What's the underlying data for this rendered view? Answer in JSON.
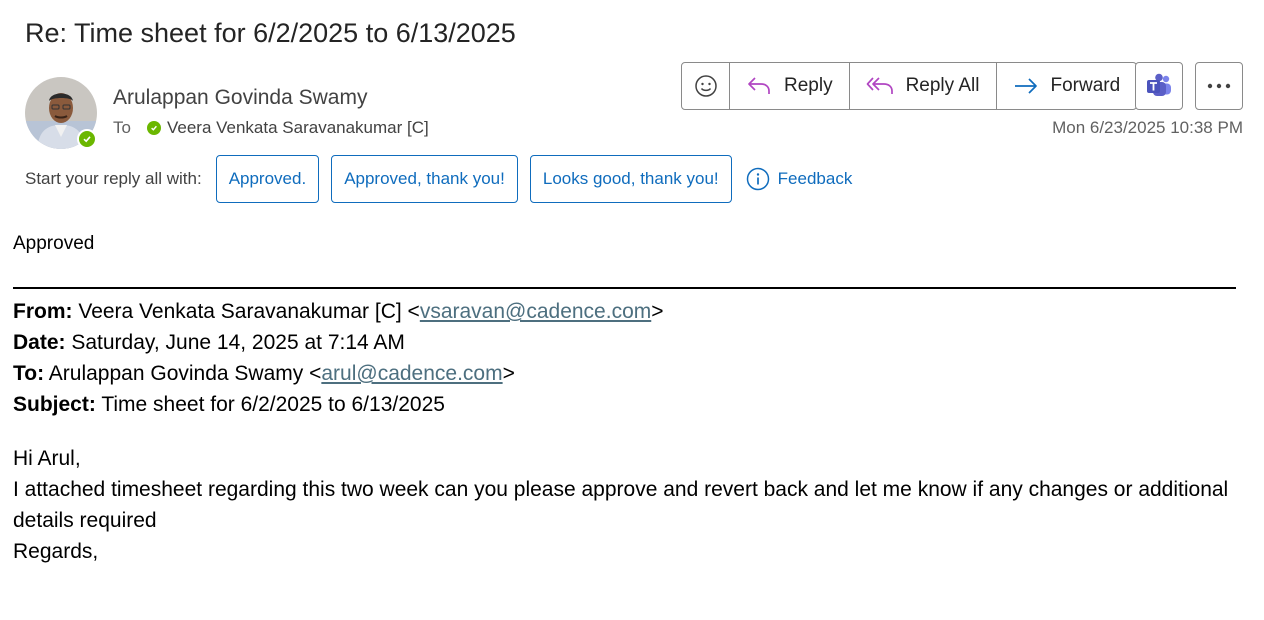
{
  "message": {
    "subject": "Re: Time sheet for 6/2/2025 to 6/13/2025",
    "sender_name": "Arulappan Govinda Swamy",
    "to_label": "To",
    "recipient": "Veera Venkata Saravanakumar [C]",
    "timestamp": "Mon 6/23/2025 10:38 PM"
  },
  "actions": {
    "reply": "Reply",
    "reply_all": "Reply All",
    "forward": "Forward"
  },
  "quick_replies": {
    "label": "Start your reply all with:",
    "options": [
      "Approved.",
      "Approved, thank you!",
      "Looks good, thank you!"
    ],
    "feedback": "Feedback"
  },
  "body": {
    "reply_text": "Approved",
    "original": {
      "from_label": "From:",
      "from_name": "Veera Venkata Saravanakumar [C] <",
      "from_email": "vsaravan@cadence.com",
      "date_label": "Date:",
      "date_value": "Saturday, June 14, 2025 at 7:14 AM",
      "to_label": "To:",
      "to_name": "Arulappan Govinda Swamy <",
      "to_email": "arul@cadence.com",
      "subject_label": "Subject:",
      "subject_value": "Time sheet for 6/2/2025 to 6/13/2025",
      "greeting": "Hi Arul,",
      "text": "I attached timesheet regarding this two week can you please approve and revert back and let me know if any changes or additional details required",
      "closing": "Regards,"
    }
  },
  "colors": {
    "accent": "#0f6cbd",
    "presence": "#6bb700",
    "reply_icon": "#b146c2",
    "forward_icon": "#0f6cbd",
    "teams": "#5b5fc7",
    "link": "#4d6f7f"
  },
  "icons": {
    "emoji": "emoji-smile-icon",
    "reply": "reply-arrow-icon",
    "reply_all": "reply-all-arrow-icon",
    "forward": "forward-arrow-icon",
    "teams": "teams-icon",
    "more": "more-horizontal-icon",
    "feedback": "info-circle-icon",
    "presence": "presence-available-icon"
  }
}
